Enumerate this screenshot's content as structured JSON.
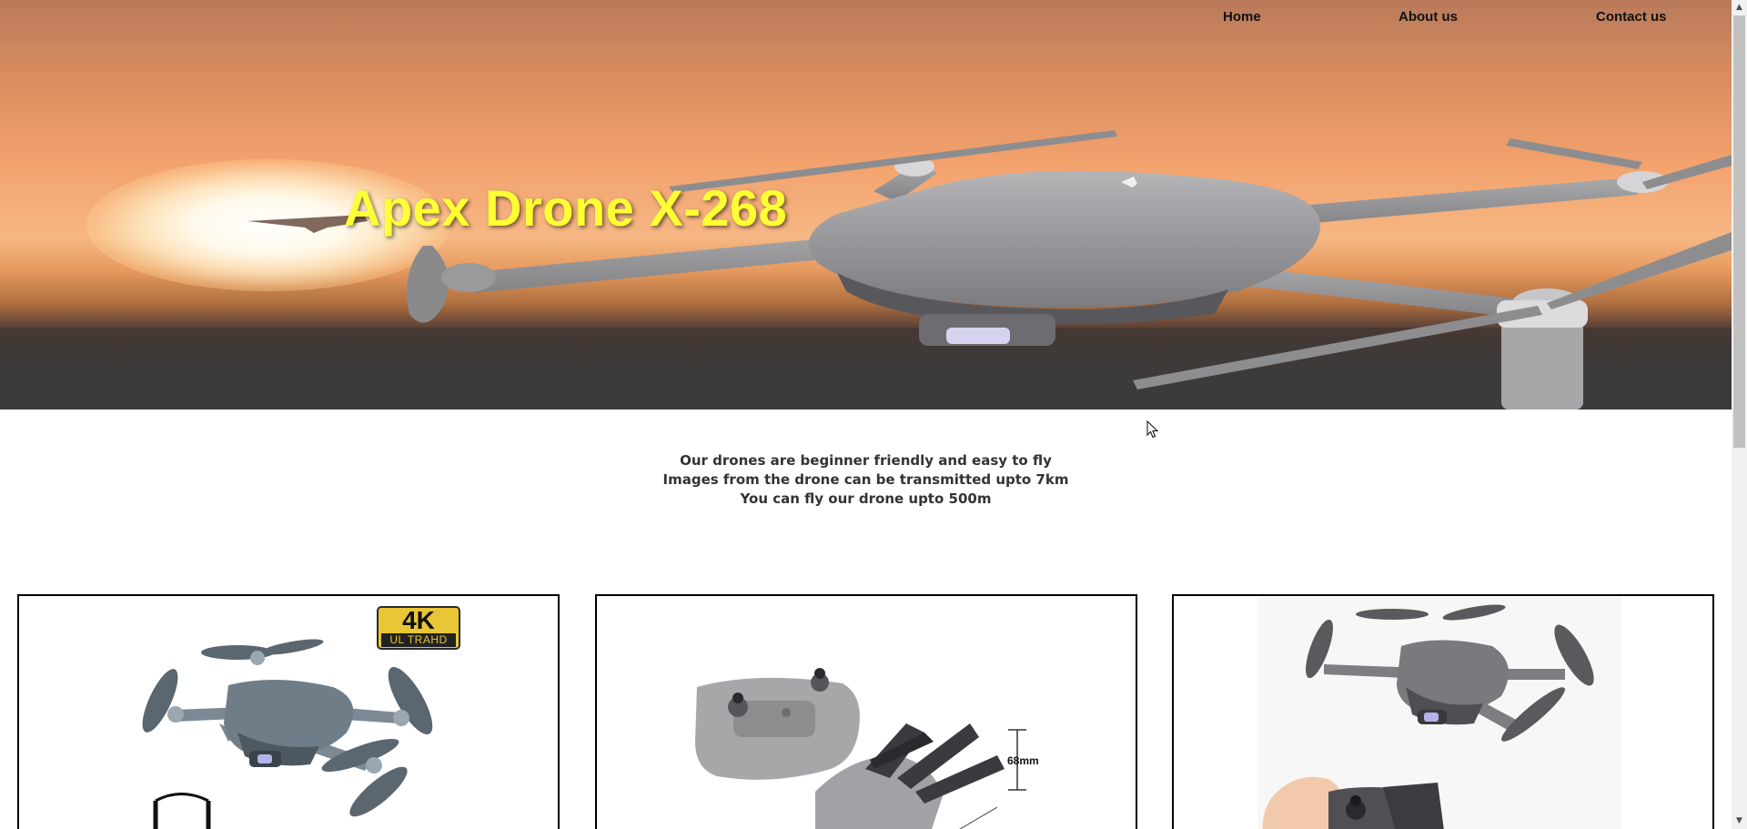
{
  "nav": {
    "home": "Home",
    "about": "About us",
    "contact": "Contact us"
  },
  "hero": {
    "title": "Apex Drone X-268",
    "title_color": "#ffff33"
  },
  "info": {
    "line1": "Our drones are beginner friendly and easy to fly",
    "line2": "Images from the drone can be transmitted upto 7km",
    "line3": "You can fly our drone upto 500m"
  },
  "cards": {
    "card1": {
      "badge_main": "4K",
      "badge_sub": "UL TRAHD"
    },
    "card2": {
      "dimension": "68mm"
    }
  }
}
